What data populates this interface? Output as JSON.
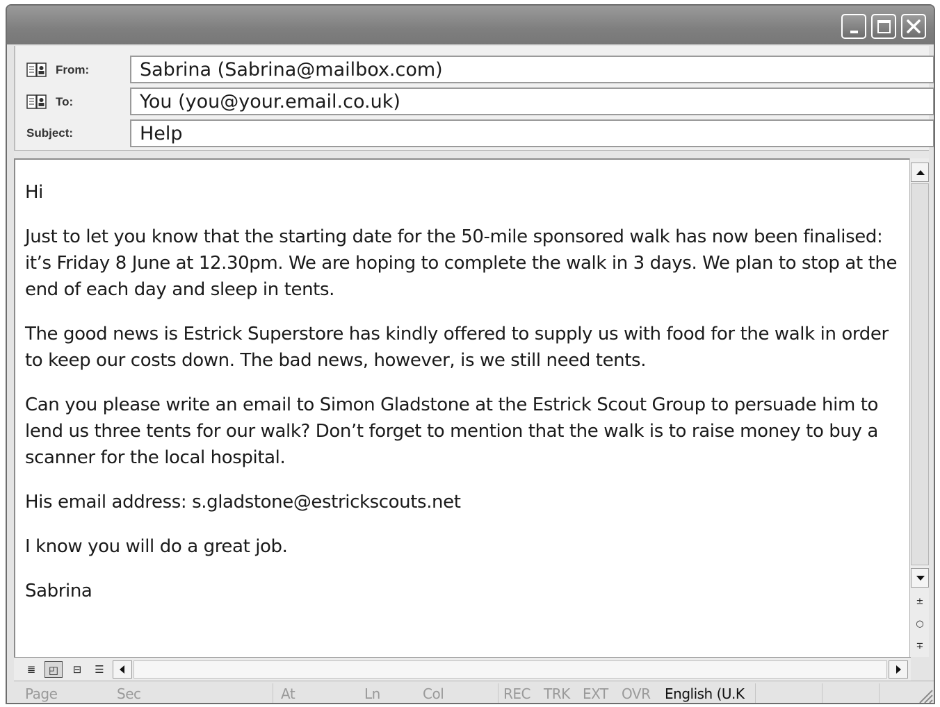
{
  "window": {
    "controls": [
      "minimize-icon",
      "maximize-icon",
      "close-icon"
    ]
  },
  "header": {
    "from_label": "From:",
    "from_value": "Sabrina (Sabrina@mailbox.com)",
    "to_label": "To:",
    "to_value": "You (you@your.email.co.uk)",
    "subject_label": "Subject:",
    "subject_value": "Help",
    "address_book_icon": "address-book-icon"
  },
  "message": {
    "paragraphs": [
      "Hi",
      "Just to let you know that the starting date for the 50-mile sponsored walk has now been finalised: it’s Friday 8 June at 12.30pm. We are hoping to complete the walk in 3 days. We plan to stop at the end of each day and sleep in tents.",
      "The good news is Estrick Superstore has kindly offered to supply us with food for the walk in order to keep our costs down.  The bad news, however, is we still need tents.",
      "Can you please write an email to Simon Gladstone at the Estrick Scout Group to persuade him to lend us three tents for our walk?  Don’t forget to mention that the walk is to raise money to buy a scanner for the local hospital.",
      "His email address: s.gladstone@estrickscouts.net",
      "I know you will do a great job.",
      "Sabrina"
    ]
  },
  "scrollbar": {
    "prev_page": "±",
    "select_browse": "○",
    "next_page": "∓"
  },
  "view_buttons": [
    "≣",
    "◰",
    "⊟",
    "☰"
  ],
  "status": {
    "page": "Page",
    "sec": "Sec",
    "at": "At",
    "ln": "Ln",
    "col": "Col",
    "rec": "REC",
    "trk": "TRK",
    "ext": "EXT",
    "ovr": "OVR",
    "language": "English (U.K"
  }
}
